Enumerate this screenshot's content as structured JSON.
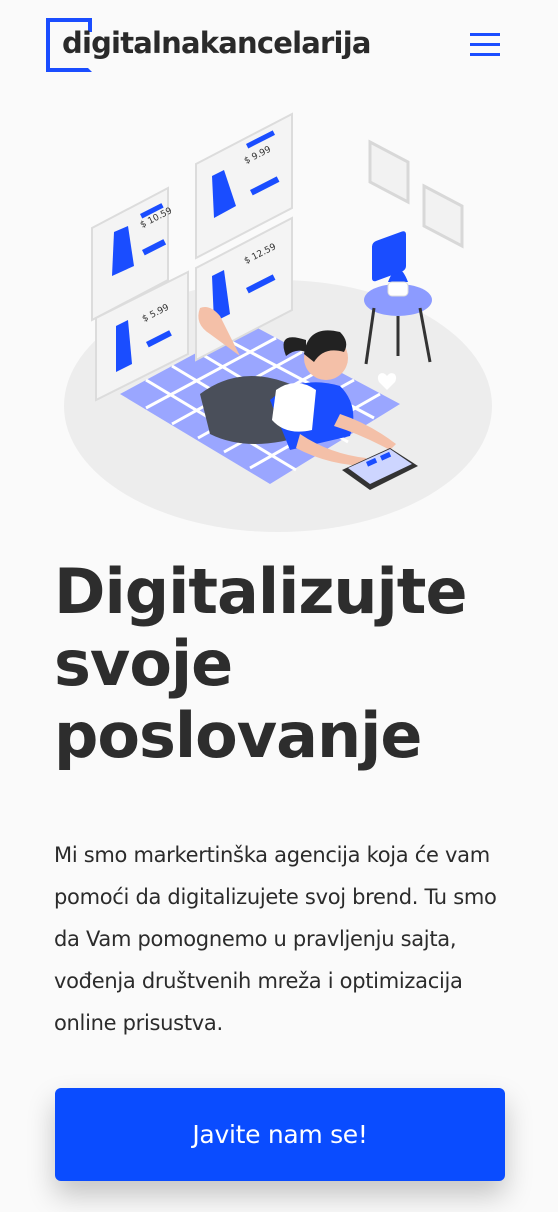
{
  "header": {
    "logo_text": "digitalnakancelarija",
    "menu_icon": "hamburger-menu-icon"
  },
  "hero": {
    "illustration": {
      "subject": "online-shopping-illustration",
      "price_tags": [
        "$ 10.59",
        "$ 9.99",
        "$ 12.59",
        "$ 5.99"
      ]
    },
    "headline": "Digitalizujte svoje poslovanje",
    "description": "Mi smo markertinška agencija koja će vam pomoći da digitalizujete svoj brend. Tu smo da Vam pomognemo u pravljenju sajta, vođenja društvenih mreža i optimizacija online prisustva.",
    "cta_label": "Javite nam se!"
  },
  "colors": {
    "accent": "#0a4cff",
    "text": "#2b2b2b",
    "background": "#fafafa"
  }
}
